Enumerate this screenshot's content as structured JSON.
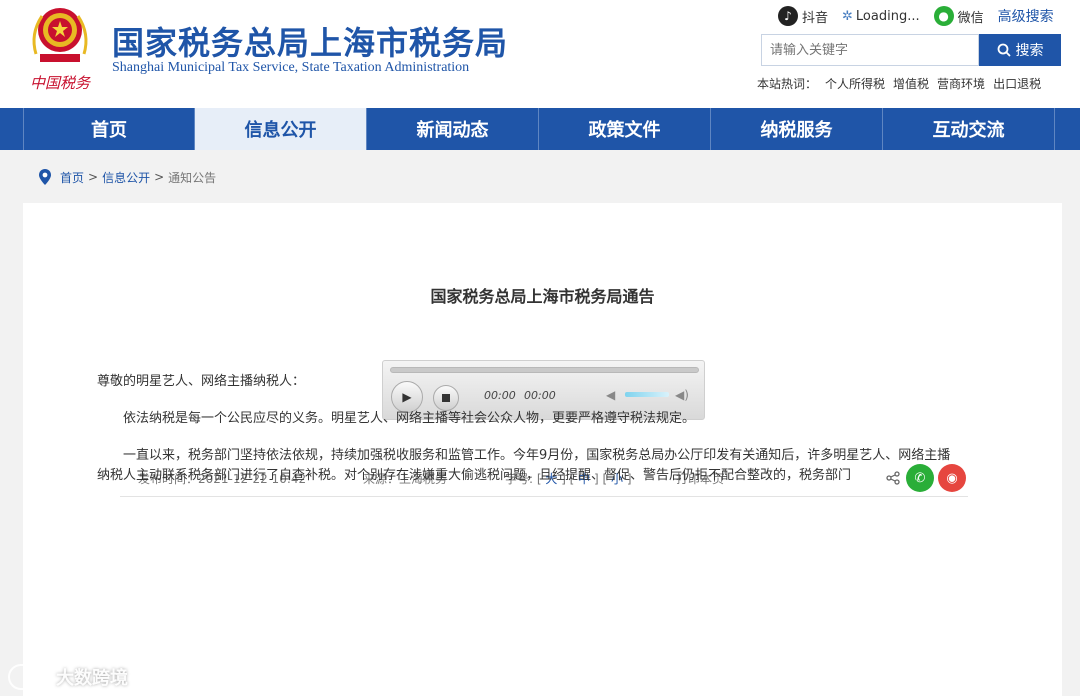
{
  "header": {
    "title": "国家税务总局上海市税务局",
    "subtitle": "Shanghai Municipal Tax Service, State Taxation Administration",
    "emblem_text": "中国税务"
  },
  "top_links": {
    "douyin": "抖音",
    "loading": "Loading...",
    "wechat": "微信",
    "advanced_search": "高级搜索"
  },
  "search": {
    "placeholder": "请输入关键字",
    "button": "搜索"
  },
  "hotwords": {
    "label": "本站热词：",
    "items": [
      "个人所得税",
      "增值税",
      "营商环境",
      "出口退税"
    ]
  },
  "nav": {
    "items": [
      "首页",
      "信息公开",
      "新闻动态",
      "政策文件",
      "纳税服务",
      "互动交流"
    ],
    "active_index": 1
  },
  "breadcrumb": {
    "home": "首页",
    "section": "信息公开",
    "current": "通知公告",
    "sep": ">"
  },
  "article": {
    "title": "国家税务总局上海市税务局通告",
    "player": {
      "current_time": "00:00",
      "duration": "00:00"
    },
    "meta": {
      "publish_time": "发布时间：2021-12-22 10:42",
      "source": "来源：上海税务",
      "font_label": "字号:",
      "font_large": "大",
      "font_medium": "中",
      "font_small": "小",
      "print": "打印本页"
    },
    "paragraphs": [
      "尊敬的明星艺人、网络主播纳税人：",
      "依法纳税是每一个公民应尽的义务。明星艺人、网络主播等社会公众人物，更要严格遵守税法规定。",
      "一直以来，税务部门坚持依法依规，持续加强税收服务和监管工作。今年9月份，国家税务总局办公厅印发有关通知后，许多明星艺人、网络主播纳税人主动联系税务部门进行了自查补税。对个别存在涉嫌重大偷逃税问题，且经提醒、督促、警告后仍拒不配合整改的，税务部门"
    ]
  },
  "watermark": "大数跨境",
  "colors": {
    "brand": "#1f55a8",
    "wechat": "#2aae38",
    "weibo": "#e6463f"
  }
}
